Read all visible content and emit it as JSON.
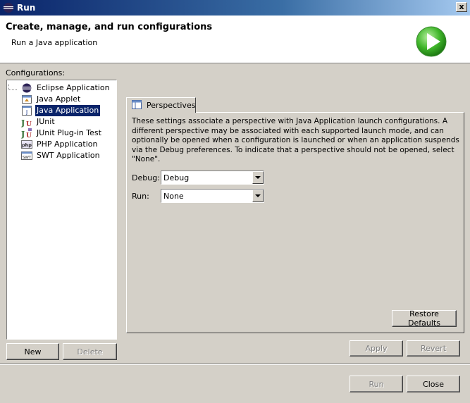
{
  "window": {
    "title": "Run",
    "close_glyph": "x"
  },
  "header": {
    "title": "Create, manage, and run configurations",
    "subtitle": "Run a Java application",
    "icon": "run-play-icon"
  },
  "configurations": {
    "label": "Configurations:",
    "items": [
      {
        "label": "Eclipse Application",
        "icon": "eclipse-icon",
        "selected": false
      },
      {
        "label": "Java Applet",
        "icon": "applet-icon",
        "selected": false
      },
      {
        "label": "Java Application",
        "icon": "java-app-icon",
        "selected": true
      },
      {
        "label": "JUnit",
        "icon": "junit-icon",
        "selected": false
      },
      {
        "label": "JUnit Plug-in Test",
        "icon": "junit-plugin-icon",
        "selected": false
      },
      {
        "label": "PHP Application",
        "icon": "php-icon",
        "selected": false
      },
      {
        "label": "SWT Application",
        "icon": "swt-icon",
        "selected": false
      }
    ],
    "new_label": "New",
    "delete_label": "Delete"
  },
  "tab": {
    "label": "Perspectives"
  },
  "perspectives": {
    "description": "These settings associate a perspective with Java Application launch configurations. A different perspective may be associated with each supported launch mode, and can optionally be opened when a configuration is launched or when an application suspends via the Debug preferences. To indicate that a perspective should not be opened, select \"None\".",
    "debug_label": "Debug:",
    "debug_value": "Debug",
    "run_label": "Run:",
    "run_value": "None",
    "restore_label": "Restore Defaults"
  },
  "actions": {
    "apply_label": "Apply",
    "revert_label": "Revert",
    "run_label": "Run",
    "close_label": "Close"
  }
}
